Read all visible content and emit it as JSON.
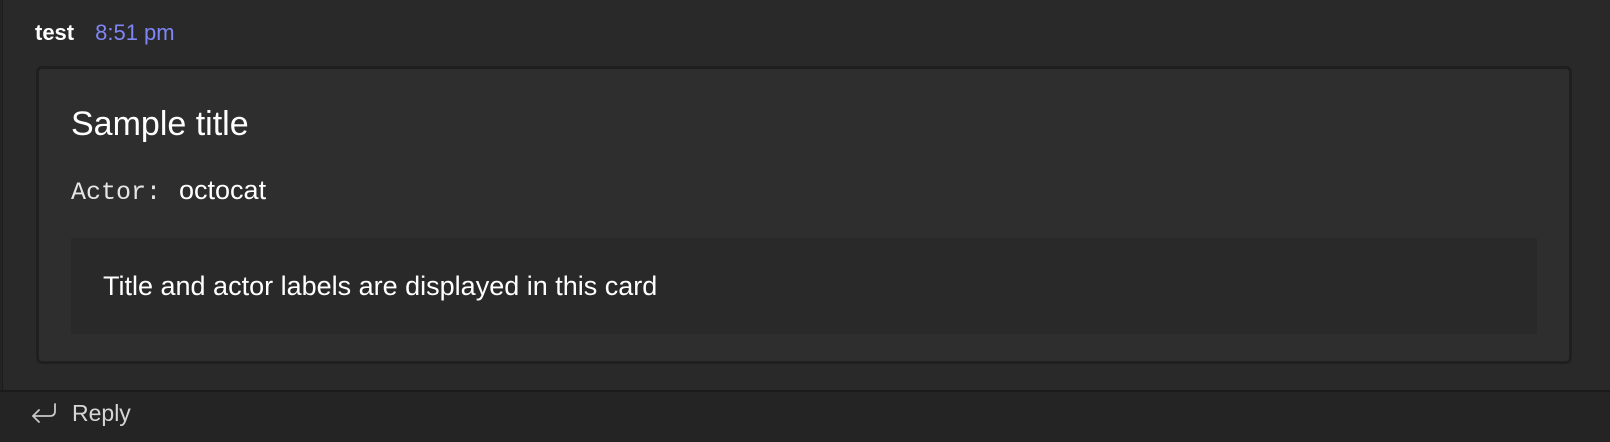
{
  "message": {
    "sender": "test",
    "timestamp": "8:51 pm"
  },
  "card": {
    "title": "Sample title",
    "actor_label": "Actor:",
    "actor_value": "octocat",
    "body_text": "Title and actor labels are displayed in this card"
  },
  "reply": {
    "label": "Reply",
    "icon": "reply-arrow-icon"
  },
  "colors": {
    "background": "#242424",
    "message_background": "#292929",
    "card_background": "#2e2e2e",
    "timestamp": "#7f85f5"
  }
}
